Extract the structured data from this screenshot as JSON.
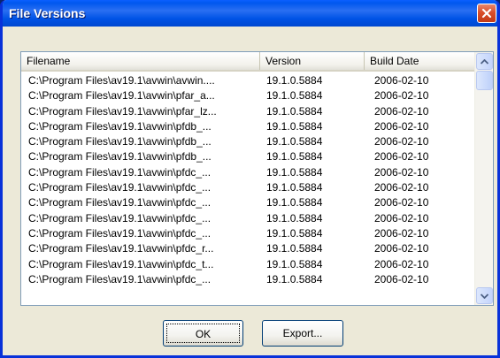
{
  "window": {
    "title": "File Versions"
  },
  "columns": {
    "filename": "Filename",
    "version": "Version",
    "build_date": "Build Date"
  },
  "rows": [
    {
      "filename": "C:\\Program Files\\av19.1\\avwin\\avwin....",
      "version": "19.1.0.5884",
      "build_date": "2006-02-10"
    },
    {
      "filename": "C:\\Program Files\\av19.1\\avwin\\pfar_a...",
      "version": "19.1.0.5884",
      "build_date": "2006-02-10"
    },
    {
      "filename": "C:\\Program Files\\av19.1\\avwin\\pfar_lz...",
      "version": "19.1.0.5884",
      "build_date": "2006-02-10"
    },
    {
      "filename": "C:\\Program Files\\av19.1\\avwin\\pfdb_...",
      "version": "19.1.0.5884",
      "build_date": "2006-02-10"
    },
    {
      "filename": "C:\\Program Files\\av19.1\\avwin\\pfdb_...",
      "version": "19.1.0.5884",
      "build_date": "2006-02-10"
    },
    {
      "filename": "C:\\Program Files\\av19.1\\avwin\\pfdb_...",
      "version": "19.1.0.5884",
      "build_date": "2006-02-10"
    },
    {
      "filename": "C:\\Program Files\\av19.1\\avwin\\pfdc_...",
      "version": "19.1.0.5884",
      "build_date": "2006-02-10"
    },
    {
      "filename": "C:\\Program Files\\av19.1\\avwin\\pfdc_...",
      "version": "19.1.0.5884",
      "build_date": "2006-02-10"
    },
    {
      "filename": "C:\\Program Files\\av19.1\\avwin\\pfdc_...",
      "version": "19.1.0.5884",
      "build_date": "2006-02-10"
    },
    {
      "filename": "C:\\Program Files\\av19.1\\avwin\\pfdc_...",
      "version": "19.1.0.5884",
      "build_date": "2006-02-10"
    },
    {
      "filename": "C:\\Program Files\\av19.1\\avwin\\pfdc_...",
      "version": "19.1.0.5884",
      "build_date": "2006-02-10"
    },
    {
      "filename": "C:\\Program Files\\av19.1\\avwin\\pfdc_r...",
      "version": "19.1.0.5884",
      "build_date": "2006-02-10"
    },
    {
      "filename": "C:\\Program Files\\av19.1\\avwin\\pfdc_t...",
      "version": "19.1.0.5884",
      "build_date": "2006-02-10"
    },
    {
      "filename": "C:\\Program Files\\av19.1\\avwin\\pfdc_...",
      "version": "19.1.0.5884",
      "build_date": "2006-02-10"
    }
  ],
  "buttons": {
    "ok": "OK",
    "export": "Export..."
  },
  "icons": {
    "close": "close-icon",
    "scroll_up": "chevron-up-icon",
    "scroll_down": "chevron-down-icon"
  },
  "colors": {
    "titlebar": "#0058ee",
    "close_button": "#d94f2b",
    "dialog_bg": "#ece9d8"
  }
}
